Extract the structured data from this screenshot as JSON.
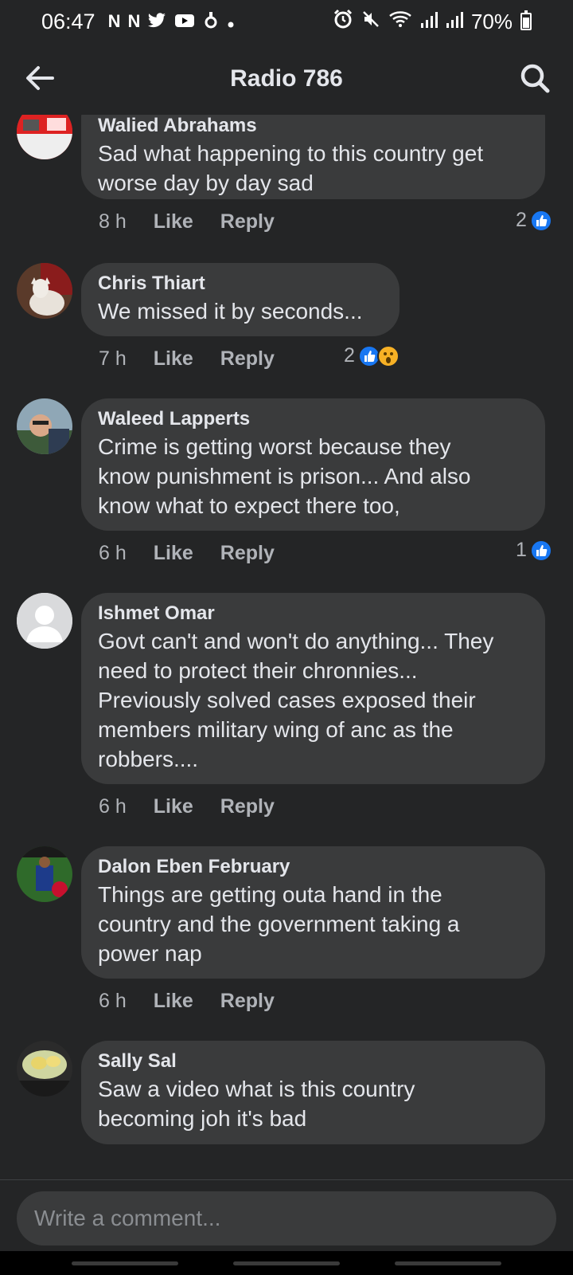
{
  "status_bar": {
    "time": "06:47",
    "notif_icons": [
      "N",
      "N"
    ],
    "battery": "70%"
  },
  "header": {
    "title": "Radio 786"
  },
  "comments": [
    {
      "author": "Walied Abrahams",
      "lines": [
        "Sad what happening to this country get",
        "worse day by day sad"
      ],
      "time": "8 h",
      "like": "Like",
      "reply": "Reply",
      "reaction_count": "2",
      "reactions": [
        "like"
      ]
    },
    {
      "author": "Chris Thiart",
      "lines": [
        "We missed it by seconds..."
      ],
      "time": "7 h",
      "like": "Like",
      "reply": "Reply",
      "reaction_count": "2",
      "reactions": [
        "like",
        "wow"
      ]
    },
    {
      "author": "Waleed Lapperts",
      "lines": [
        "Crime is getting worst because they",
        "know punishment is prison...  And also",
        "know what to expect there too,"
      ],
      "time": "6 h",
      "like": "Like",
      "reply": "Reply",
      "reaction_count": "1",
      "reactions": [
        "like"
      ]
    },
    {
      "author": "Ishmet Omar",
      "lines": [
        "Govt can't and won't do anything... They",
        "need to protect their chronnies...",
        "Previously  solved cases exposed their",
        "members  military wing of anc  as the",
        "robbers...."
      ],
      "time": "6 h",
      "like": "Like",
      "reply": "Reply"
    },
    {
      "author": "Dalon Eben February",
      "lines": [
        "Things are getting outa hand in the",
        "country and the government taking a",
        "power nap"
      ],
      "time": "6 h",
      "like": "Like",
      "reply": "Reply"
    },
    {
      "author": "Sally Sal",
      "lines": [
        "Saw a video what is this country",
        "becoming joh it's bad"
      ]
    }
  ],
  "composer": {
    "placeholder": "Write a comment..."
  },
  "colors": {
    "background": "#242526",
    "bubble": "#3a3b3c",
    "like_blue": "#1877f2",
    "wow_yellow": "#f7b125"
  }
}
